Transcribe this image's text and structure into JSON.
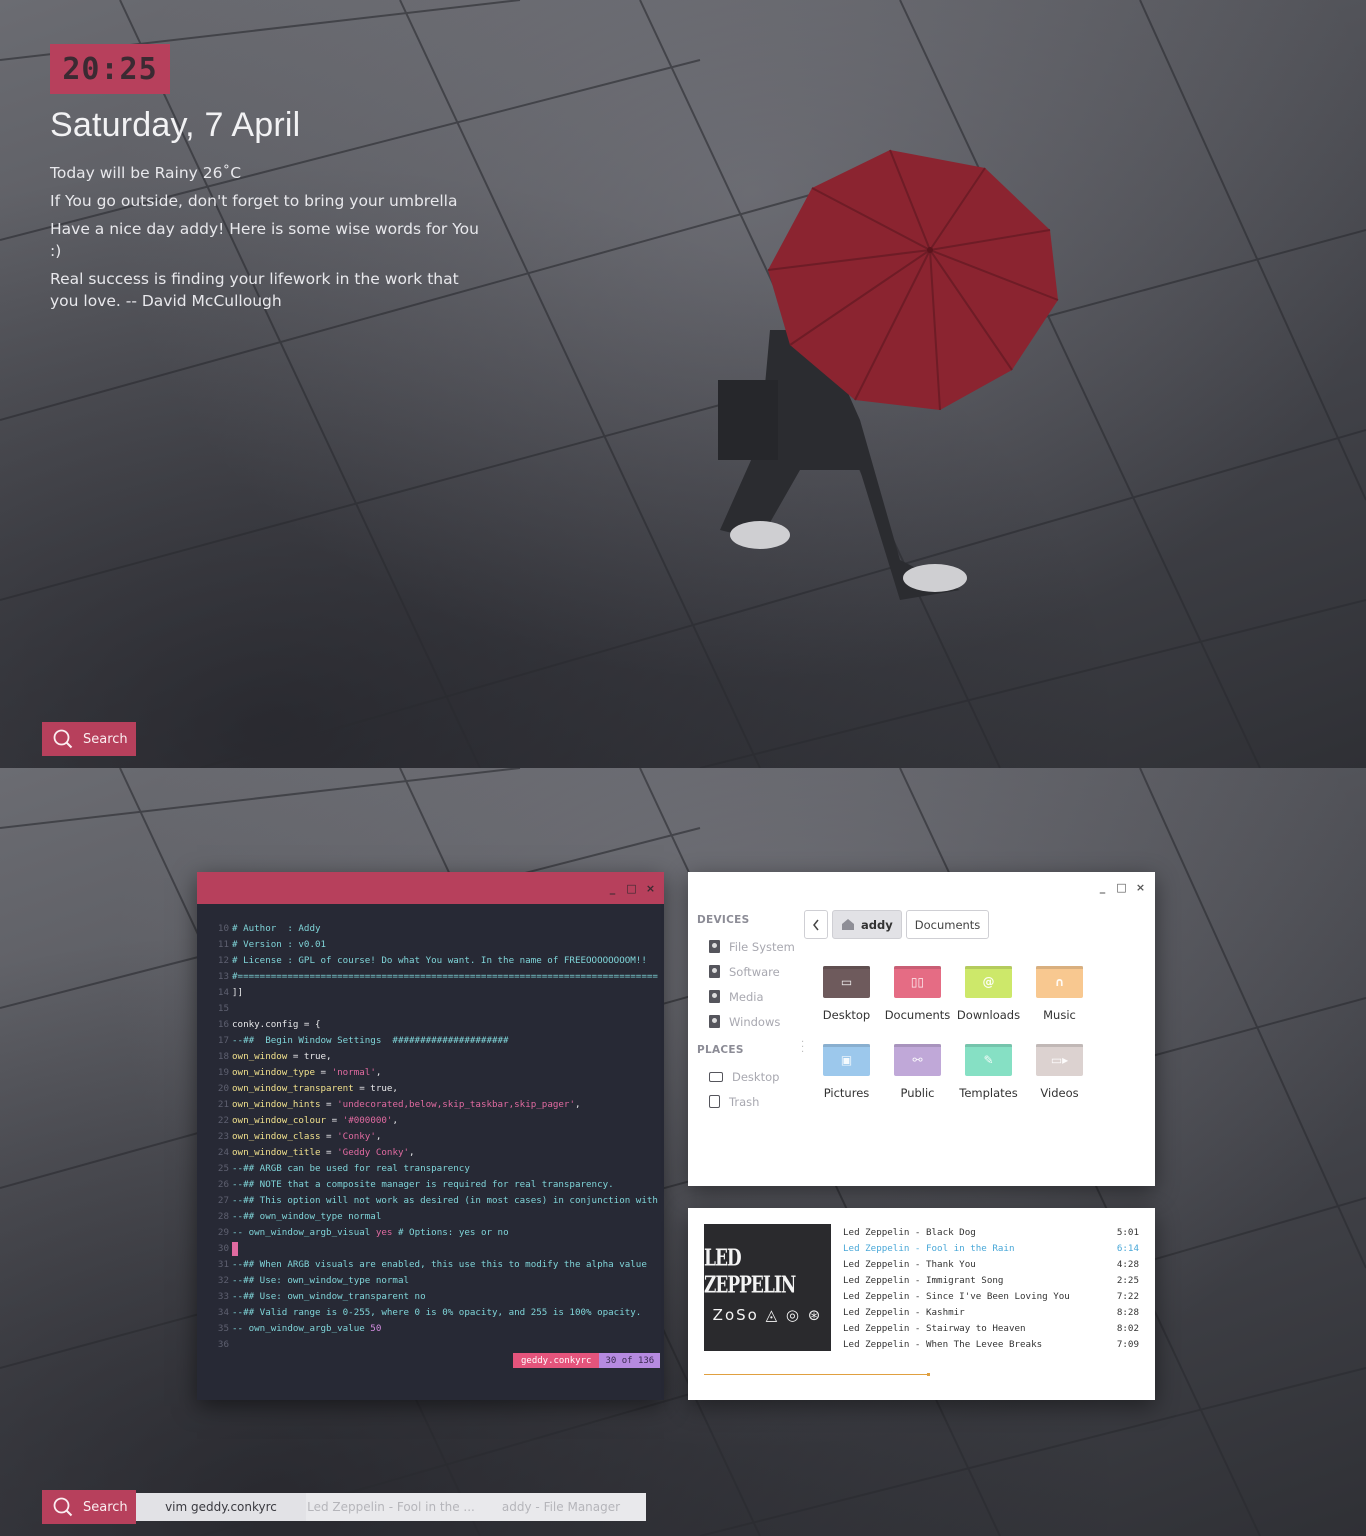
{
  "conky": {
    "time": "20:25",
    "date": "Saturday, 7 April",
    "weather": "Today will be Rainy 26˚C",
    "advice": "If You go outside, don't forget to bring your umbrella",
    "greeting": "Have a nice day addy! Here is some wise words for You :)",
    "quote_line1": "Real success is finding your lifework in the work that",
    "quote_line2": "you love.  -- David McCullough"
  },
  "panel": {
    "search_label": "Search",
    "tasks": [
      {
        "label": "vim geddy.conkyrc",
        "active": true
      },
      {
        "label": "Led Zeppelin - Fool in the ...",
        "active": false
      },
      {
        "label": "addy - File Manager",
        "active": false
      }
    ]
  },
  "terminal": {
    "controls": [
      "_",
      "□",
      "×"
    ],
    "lines": [
      {
        "n": "10",
        "text": "# Author  : Addy"
      },
      {
        "n": "11",
        "text": "# Version : v0.01"
      },
      {
        "n": "12",
        "text": "# License : GPL of course! Do what You want. In the name of FREEOOOOOOOOM!!"
      },
      {
        "n": "13",
        "text": "#============================================================================"
      },
      {
        "n": "14",
        "text": "]]"
      },
      {
        "n": "15",
        "text": ""
      },
      {
        "n": "16",
        "text": "conky.config = {"
      },
      {
        "n": "17",
        "text": "--##  Begin Window Settings  #####################"
      },
      {
        "n": "18",
        "key": "own_window",
        "rest": " = true,"
      },
      {
        "n": "19",
        "key": "own_window_type",
        "rest": " = ",
        "str": "'normal'",
        "end": ","
      },
      {
        "n": "20",
        "key": "own_window_transparent",
        "rest": " = true,"
      },
      {
        "n": "21",
        "key": "own_window_hints",
        "rest": " = ",
        "str": "'undecorated,below,skip_taskbar,skip_pager'",
        "end": ","
      },
      {
        "n": "22",
        "key": "own_window_colour",
        "rest": " = ",
        "str": "'#000000'",
        "end": ","
      },
      {
        "n": "23",
        "key": "own_window_class",
        "rest": " = ",
        "str": "'Conky'",
        "end": ","
      },
      {
        "n": "24",
        "key": "own_window_title",
        "rest": " = ",
        "str": "'Geddy Conky'",
        "end": ","
      },
      {
        "n": "25",
        "text": "--## ARGB can be used for real transparency"
      },
      {
        "n": "26",
        "text": "--## NOTE that a composite manager is required for real transparency."
      },
      {
        "n": "27",
        "text": "--## This option will not work as desired (in most cases) in conjunction with"
      },
      {
        "n": "28",
        "text": "--## own_window_type normal"
      },
      {
        "n": "29",
        "text": "-- own_window_argb_visual yes # Options: yes or no"
      },
      {
        "n": "30",
        "text": ""
      },
      {
        "n": "31",
        "text": "--## When ARGB visuals are enabled, this use this to modify the alpha value"
      },
      {
        "n": "32",
        "text": "--## Use: own_window_type normal"
      },
      {
        "n": "33",
        "text": "--## Use: own_window_transparent no"
      },
      {
        "n": "34",
        "text": "--## Valid range is 0-255, where 0 is 0% opacity, and 255 is 100% opacity."
      },
      {
        "n": "35",
        "text": "-- own_window_argb_value 50"
      },
      {
        "n": "36",
        "text": ""
      }
    ],
    "status_file": "geddy.conkyrc",
    "status_pos": "30 of 136"
  },
  "file_manager": {
    "controls": [
      "_",
      "□",
      "×"
    ],
    "devices_heading": "DEVICES",
    "devices": [
      "File System",
      "Software",
      "Media",
      "Windows"
    ],
    "places_heading": "PLACES",
    "places": [
      {
        "label": "Desktop",
        "icon": "monitor-icon"
      },
      {
        "label": "Trash",
        "icon": "trash-icon"
      }
    ],
    "breadcrumb_home": "addy",
    "breadcrumb_current": "Documents",
    "folders": [
      {
        "label": "Desktop",
        "color": "#6e5a5c",
        "glyph": "▭"
      },
      {
        "label": "Documents",
        "color": "#e56c84",
        "glyph": "▯▯"
      },
      {
        "label": "Downloads",
        "color": "#cde86a",
        "glyph": "@"
      },
      {
        "label": "Music",
        "color": "#f8c890",
        "glyph": "∩"
      },
      {
        "label": "Pictures",
        "color": "#9cc8ec",
        "glyph": "▣"
      },
      {
        "label": "Public",
        "color": "#c0a8d8",
        "glyph": "⚯"
      },
      {
        "label": "Templates",
        "color": "#86e0c4",
        "glyph": "✎"
      },
      {
        "label": "Videos",
        "color": "#dcd2d0",
        "glyph": "▭▸"
      }
    ]
  },
  "player": {
    "cover_band": "LED ZEPPELIN",
    "cover_symbols": "ZoSo ◬ ◎ ⊛",
    "progress": 0.5,
    "tracks": [
      {
        "title": "Led Zeppelin - Black Dog",
        "time": "5:01",
        "playing": false
      },
      {
        "title": "Led Zeppelin - Fool in the Rain",
        "time": "6:14",
        "playing": true
      },
      {
        "title": "Led Zeppelin - Thank You",
        "time": "4:28",
        "playing": false
      },
      {
        "title": "Led Zeppelin - Immigrant Song",
        "time": "2:25",
        "playing": false
      },
      {
        "title": "Led Zeppelin - Since I've Been Loving You",
        "time": "7:22",
        "playing": false
      },
      {
        "title": "Led Zeppelin - Kashmir",
        "time": "8:28",
        "playing": false
      },
      {
        "title": "Led Zeppelin - Stairway to Heaven",
        "time": "8:02",
        "playing": false
      },
      {
        "title": "Led Zeppelin - When The Levee Breaks",
        "time": "7:09",
        "playing": false
      }
    ]
  },
  "colors": {
    "accent": "#b7405c",
    "terminal_bg": "#272935",
    "playing_track": "#4aa8d8"
  }
}
